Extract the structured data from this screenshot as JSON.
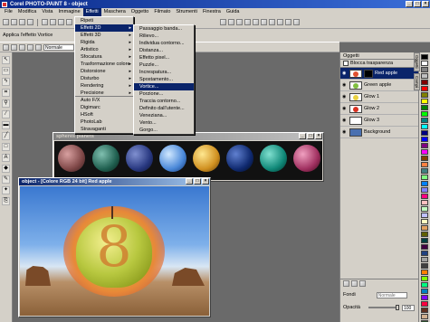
{
  "window": {
    "title": "Corel PHOTO-PAINT 8 - object"
  },
  "menubar": [
    "File",
    "Modifica",
    "Vista",
    "Immagine",
    "Effetti",
    "Maschera",
    "Oggetto",
    "Filmato",
    "Strumenti",
    "Finestra",
    "Guida"
  ],
  "menubar_active": "Effetti",
  "property_bar": {
    "label": "Applica l'effetto Vortice",
    "mode_select": "Normale"
  },
  "effects_menu": {
    "items": [
      "Ripeti",
      "Effetti 2D",
      "Effetti 3D",
      "Rigida",
      "Artistico",
      "Sfocatura",
      "Trasformazione colore",
      "Distorsione",
      "Disturbo",
      "Rendering",
      "Precisione",
      "Auto F/X",
      "Digimarc",
      "HSoft",
      "PhotoLab",
      "Stravaganti"
    ],
    "selected": "Effetti 2D"
  },
  "effects2d_menu": {
    "items": [
      "Passaggio banda...",
      "Rilievo...",
      "Individua contorno...",
      "Distanza...",
      "Effetto pixel...",
      "Puzzle...",
      "Increspatura...",
      "Spostamento...",
      "Vortice...",
      "Porzione...",
      "Traccia contorno...",
      "Definito dall'utente...",
      "Veneziana...",
      "Vento...",
      "Gorgo..."
    ],
    "selected": "Vortice..."
  },
  "planets_window": {
    "title": "spheres planets"
  },
  "object_window": {
    "title": "object - [Colore RGB 24 bit] Red apple"
  },
  "objects_panel": {
    "title": "Oggetti",
    "lock_transparency": "Blocca trasparenza",
    "layers": [
      {
        "name": "Red apple",
        "selected": true,
        "color": "#e05030"
      },
      {
        "name": "Green apple",
        "selected": false,
        "color": "#80c040"
      },
      {
        "name": "Glow 1",
        "selected": false,
        "color": "#e8d040"
      },
      {
        "name": "Glow 2",
        "selected": false,
        "color": "#d83020"
      },
      {
        "name": "Glow 3",
        "selected": false,
        "color": "#ffffff"
      },
      {
        "name": "Background",
        "selected": false,
        "color": "#4a70b0"
      }
    ],
    "merge_label": "Fondi",
    "merge_value": "Normale",
    "opacity_label": "Opacità",
    "opacity_value": "100"
  },
  "side_tabs": [
    "Oggetti",
    "Campi"
  ],
  "palette": [
    "#000000",
    "#ffffff",
    "#808080",
    "#c0c0c0",
    "#800000",
    "#ff0000",
    "#808000",
    "#ffff00",
    "#008000",
    "#00ff00",
    "#008080",
    "#00ffff",
    "#000080",
    "#0000ff",
    "#800080",
    "#ff00ff",
    "#804000",
    "#ff8040",
    "#408080",
    "#80ff80",
    "#0080ff",
    "#8080ff",
    "#ff0080",
    "#ffc0c0",
    "#c0ffc0",
    "#c0c0ff",
    "#ffffc0",
    "#e0a060",
    "#606000",
    "#004040",
    "#400040",
    "#204080",
    "#a0a0a0",
    "#404040",
    "#ff8000",
    "#80ff00",
    "#00ff80",
    "#0080c0",
    "#8000ff",
    "#ff0040",
    "#603020",
    "#d0b090",
    "#305030"
  ],
  "apple_numeral": "8"
}
